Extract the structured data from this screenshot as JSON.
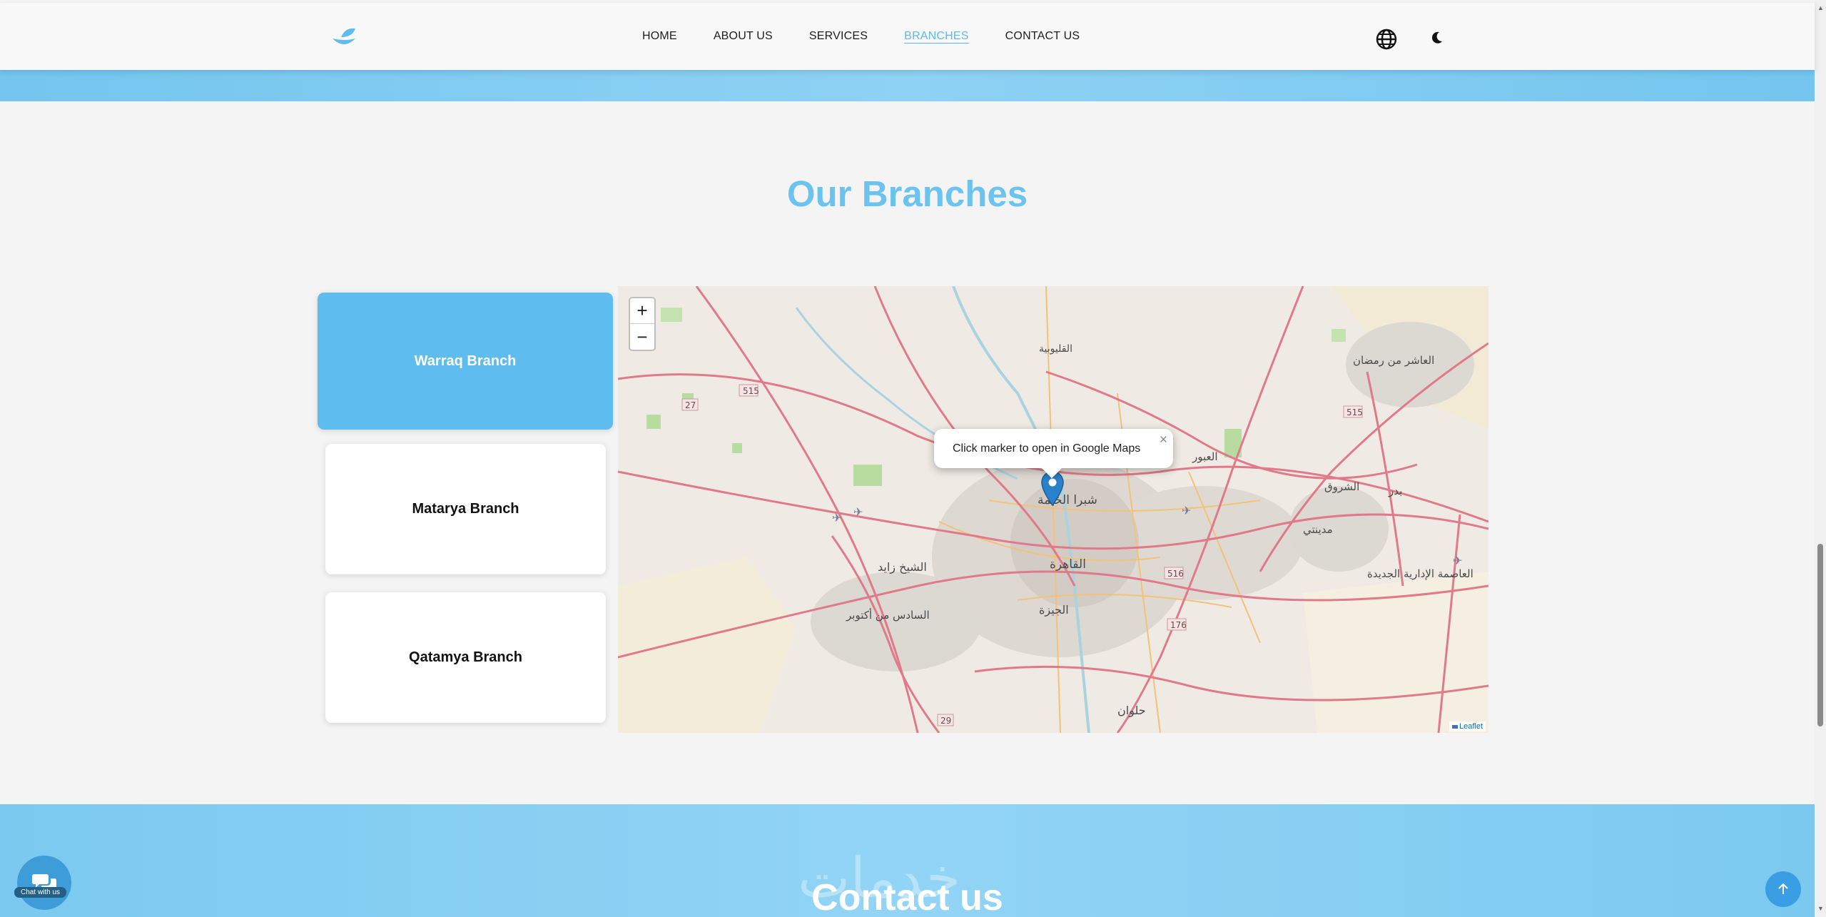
{
  "header": {
    "logo_icon": "leaf-bowl-logo",
    "nav": [
      {
        "label": "HOME"
      },
      {
        "label": "ABOUT US"
      },
      {
        "label": "SERVICES"
      },
      {
        "label": "BRANCHES"
      },
      {
        "label": "CONTACT US"
      }
    ],
    "active_nav": "BRANCHES",
    "language_icon": "globe-icon",
    "theme_icon": "moon-icon"
  },
  "branches": {
    "title": "Our Branches",
    "items": [
      {
        "label": "Warraq Branch",
        "active": true
      },
      {
        "label": "Matarya Branch",
        "active": false
      },
      {
        "label": "Qatamya Branch",
        "active": false
      }
    ]
  },
  "map": {
    "zoom_in": "+",
    "zoom_out": "−",
    "popup_text": "Click marker to open in Google Maps",
    "popup_close": "×",
    "attribution": "Leaflet",
    "labels": {
      "cairo": "القاهرة",
      "giza": "الجيزة",
      "shubra": "شبرا الخيمة",
      "sheikh_zayed": "الشيخ زايد",
      "october": "السادس من أكتوبر",
      "helwan": "حلوان",
      "shorouk": "الشروق",
      "badr": "بدر",
      "obour": "العبور",
      "madinaty": "مدينتي",
      "tenth": "العاشر من رمضان",
      "new_capital": "العاصمة الإدارية الجديدة",
      "qalyubia": "القليوبية",
      "roads": [
        "515",
        "27",
        "515",
        "516",
        "176",
        "29"
      ]
    },
    "colors": {
      "road_major": "#e07a8a",
      "road_minor": "#f2c27a",
      "urban": "#d9d4cd",
      "green": "#b8dca0",
      "water": "#aad3df"
    }
  },
  "contact": {
    "title": "Contact us",
    "watermark": "خدمات"
  },
  "widgets": {
    "chat_label": "Chat with us",
    "chat_icon": "chat-bubbles-icon",
    "scroll_top_icon": "arrow-up-icon"
  },
  "accent_color": "#5ebcef"
}
